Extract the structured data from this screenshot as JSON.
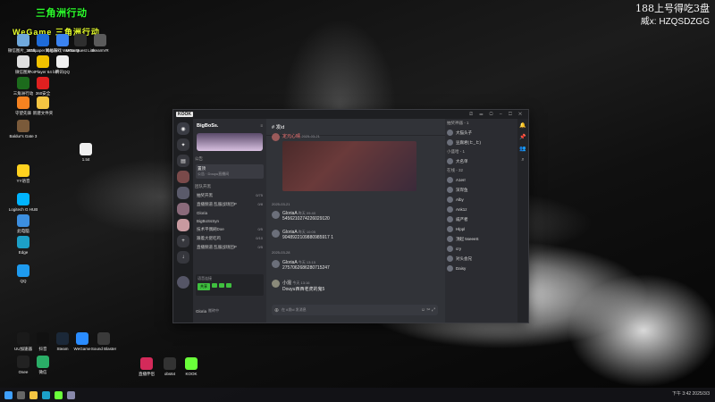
{
  "desktop": {
    "banner_top": "三角洲行动",
    "banner_bottom": "WeGame 三角洲行动",
    "icons": [
      {
        "label": "微信图片_2025...",
        "color": "#6fa8dc"
      },
      {
        "label": "Wallpaper Engine",
        "color": "#1e6bd8"
      },
      {
        "label": "网易游戏 WeGame",
        "color": "#3b83f0"
      },
      {
        "label": "Meta Quest Link",
        "color": "#2f2f2f"
      },
      {
        "label": "SteamVR",
        "color": "#5b5b5b"
      },
      {
        "label": "微信图片",
        "color": "#e0e0e0"
      },
      {
        "label": "PotPlayer 64 bit",
        "color": "#f2c200"
      },
      {
        "label": "腾讯QQ",
        "color": "#f0f0f0"
      },
      {
        "label": "三角洲行动",
        "color": "#1c6b1c"
      },
      {
        "label": "360安全",
        "color": "#e02020"
      },
      {
        "label": "守望先锋",
        "color": "#f58220"
      },
      {
        "label": "新建文件夹",
        "color": "#f5c542"
      },
      {
        "label": "Baldur's Gate 3",
        "color": "#7a5a3a"
      },
      {
        "label": "1.txt",
        "color": "#f0f0f0"
      },
      {
        "label": "YY语音",
        "color": "#ffd21f"
      },
      {
        "label": "Logitech G HUB",
        "color": "#00b4ff"
      },
      {
        "label": "此电脑",
        "color": "#3c8fe0"
      },
      {
        "label": "Edge",
        "color": "#1ca0c8"
      },
      {
        "label": "QQ",
        "color": "#1e9bf0"
      },
      {
        "label": "UU加速器",
        "color": "#1a1a1a"
      },
      {
        "label": "抖音",
        "color": "#111"
      },
      {
        "label": "Steam",
        "color": "#1b2838"
      },
      {
        "label": "WeGame",
        "color": "#2a8cff"
      },
      {
        "label": "Sound Blaster",
        "color": "#3a3a3a"
      },
      {
        "label": "Osee",
        "color": "#222"
      },
      {
        "label": "微信",
        "color": "#2aae67"
      },
      {
        "label": "直播伴侣",
        "color": "#d42a5a"
      },
      {
        "label": "obs64",
        "color": "#333"
      },
      {
        "label": "KOOK",
        "color": "#6aff3a"
      }
    ]
  },
  "overlay": {
    "line1": "188上号得吃3盘",
    "line2": "威x: HZQSDZGG"
  },
  "taskbar": {
    "time": "下午 3:42",
    "date": "2025/3/3"
  },
  "app": {
    "logo": "KOOK",
    "server_name": "BigBoSs.",
    "channel_group_1": "公告",
    "channel_pinned": "置顶",
    "channel_pinned_sub": "公告 · Douyu直播间",
    "channel_group_2": "团队开黑",
    "voice_channels": [
      {
        "name": "抽奖开黑",
        "count": "0/75"
      },
      {
        "name": "直播频道 乱服战场团P",
        "count": "0/8"
      },
      {
        "name": "Gloria",
        "count": ""
      },
      {
        "name": "BigBoSsSyn",
        "count": ""
      },
      {
        "name": "技术平偶刷Doe",
        "count": "0/5"
      },
      {
        "name": "跟着大佬吃鸡",
        "count": "0/10"
      },
      {
        "name": "直播频道 乱服战场团P",
        "count": "0/5"
      }
    ],
    "user_panel": "语音连接",
    "user_name": "Gloria",
    "user_status": "搬砖中",
    "chat_channel": "# 发id",
    "messages": [
      {
        "author": "定元心晴",
        "time": "2025-03-21",
        "text": ""
      },
      {
        "author": "GloriaA",
        "time": "昨天 09:40",
        "text": "5456210274226029120"
      },
      {
        "author": "GloriaA",
        "time": "昨天 10:05",
        "text": "9048922109880985917 1"
      },
      {
        "author": "GloriaA",
        "time": "今天 13:15",
        "text": "2757062686280715247"
      },
      {
        "author": "小混",
        "time": "今天 13:16",
        "text": "Douyu西西老虎的鬼5"
      }
    ],
    "date_divider_1": "2025-03-21",
    "date_divider_2": "2025-03-28",
    "input_placeholder": "在 #发id 发消息",
    "member_groups": [
      {
        "title": "抽奖神器 - 1",
        "members": [
          "大猫头子",
          "豆腐君(ヒ_ヒ)"
        ]
      },
      {
        "title": "小盛哈 - 1",
        "members": [
          "大名单"
        ]
      },
      {
        "title": "在线 - 32",
        "members": [
          "A1err",
          "深岸鱼",
          "Alby",
          "Ank1z",
          "威严者",
          "Hlppl",
          "顶起 5seeeS",
          "cry",
          "对头会兄",
          "Daisy"
        ]
      }
    ]
  }
}
